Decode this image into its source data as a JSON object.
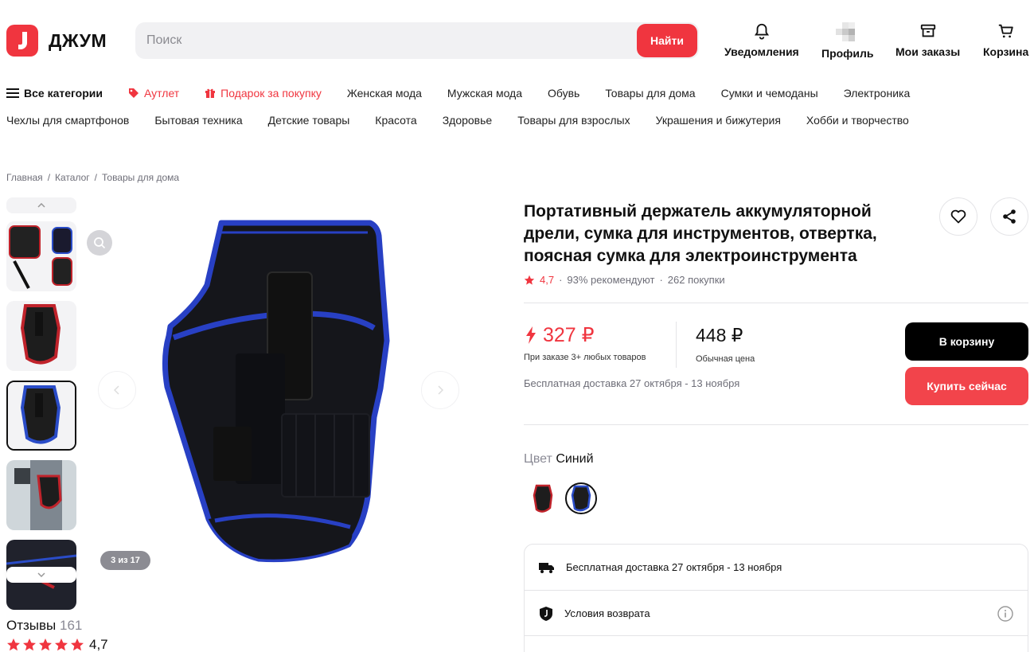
{
  "brand": {
    "name": "ДЖУМ",
    "accent": "#f0353f"
  },
  "search": {
    "placeholder": "Поиск",
    "button": "Найти"
  },
  "top_actions": [
    {
      "label": "Уведомления",
      "icon": "bell-icon"
    },
    {
      "label": "Профиль",
      "icon": "avatar"
    },
    {
      "label": "Мои заказы",
      "icon": "box-icon"
    },
    {
      "label": "Корзина",
      "icon": "cart-icon"
    }
  ],
  "nav": {
    "row1": [
      "Все категории",
      "Аутлет",
      "Подарок за покупку",
      "Женская мода",
      "Мужская мода",
      "Обувь",
      "Товары для дома",
      "Сумки и чемоданы",
      "Электроника"
    ],
    "row2": [
      "Чехлы для смартфонов",
      "Бытовая техника",
      "Детские товары",
      "Красота",
      "Здоровье",
      "Товары для взрослых",
      "Украшения и бижутерия",
      "Хобби и творчество"
    ]
  },
  "breadcrumb": [
    "Главная",
    "Каталог",
    "Товары для дома"
  ],
  "gallery": {
    "counter": "3 из 17"
  },
  "product": {
    "title": "Портативный держатель аккумуляторной дрели, сумка для инструментов, отвертка, поясная сумка для электроинструмента",
    "rating": "4,7",
    "recommend": "93% рекомендуют",
    "purchases": "262 покупки",
    "promo_price": "327 ₽",
    "promo_note": "При заказе 3+ любых товаров",
    "regular_price": "448 ₽",
    "regular_note": "Обычная цена",
    "delivery": "Бесплатная доставка 27 октября - 13 ноября",
    "cart_button": "В корзину",
    "buy_button": "Купить сейчас",
    "color_key": "Цвет",
    "color_value": "Синий"
  },
  "info_rows": [
    {
      "text": "Бесплатная доставка 27 октября - 13 ноября",
      "icon": "truck-icon"
    },
    {
      "text": "Условия возврата",
      "icon": "shield-icon"
    }
  ],
  "reviews": {
    "title": "Отзывы",
    "count": "161",
    "rating": "4,7"
  }
}
